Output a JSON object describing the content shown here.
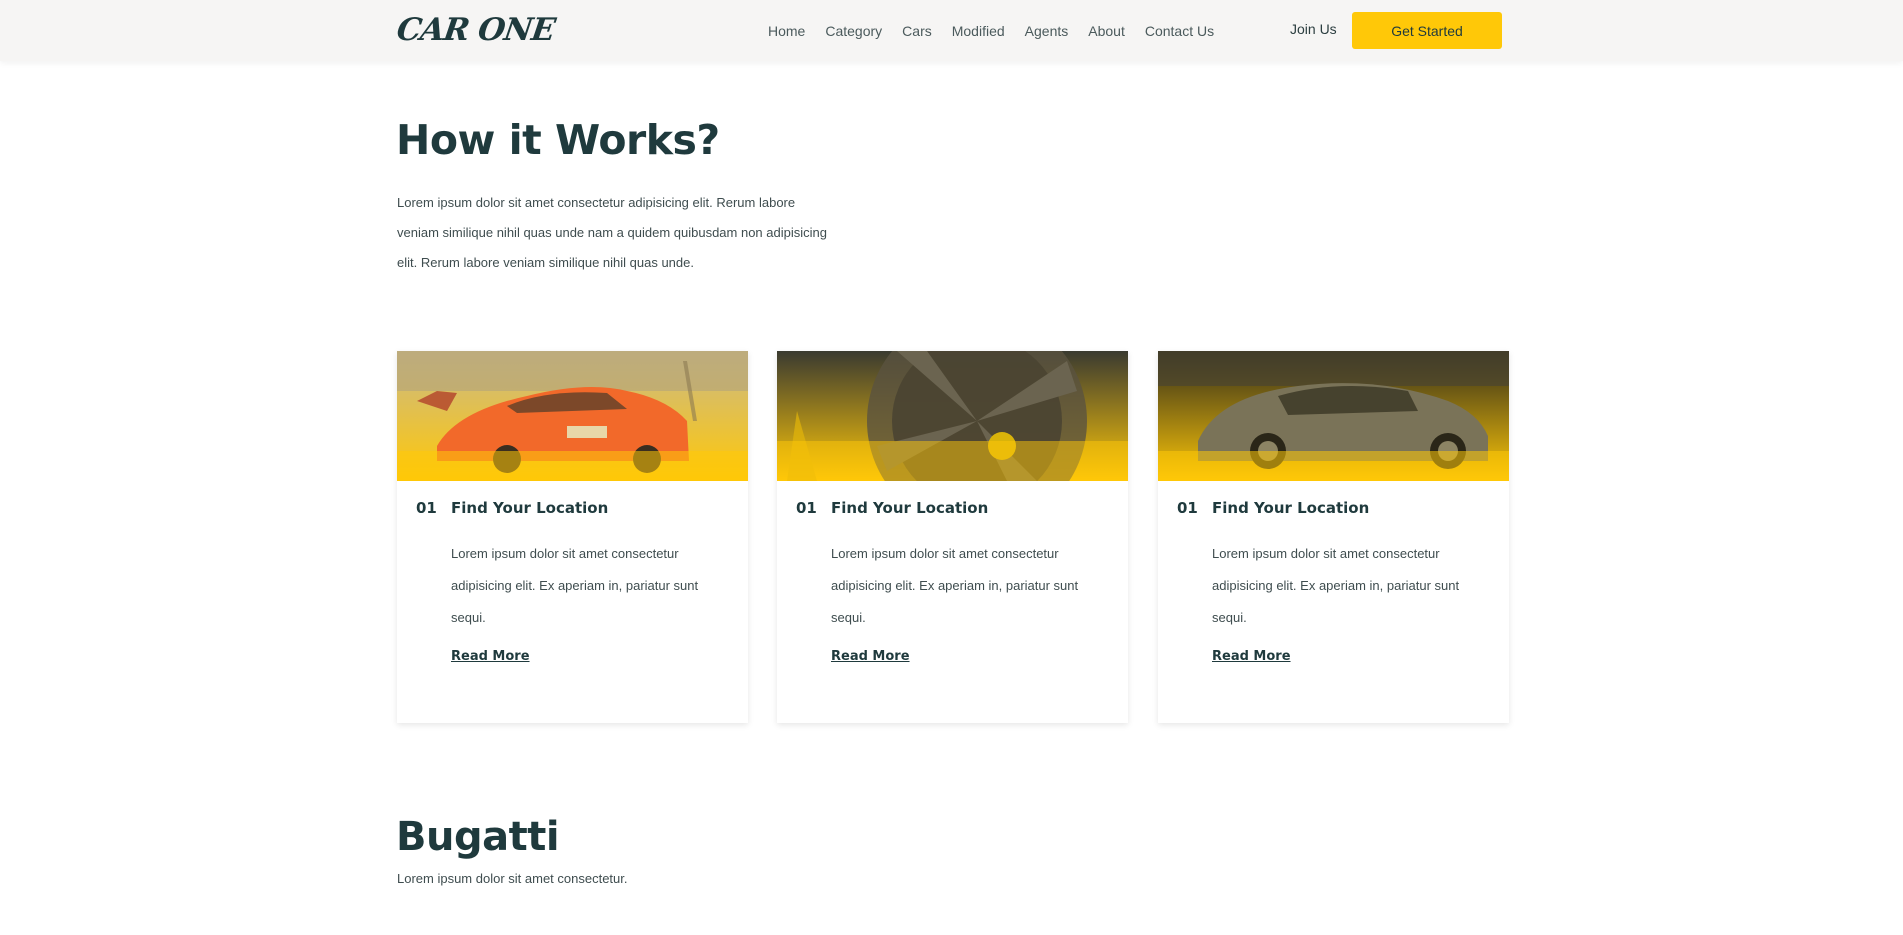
{
  "header": {
    "logo_text": "CAR ONE",
    "nav_items": [
      "Home",
      "Category",
      "Cars",
      "Modified",
      "Agents",
      "About",
      "Contact Us"
    ],
    "join_label": "Join Us",
    "cta_label": "Get Started",
    "cta_color": "#ffc808"
  },
  "how_it_works": {
    "title": "How it Works?",
    "description": "Lorem ipsum dolor sit amet consectetur adipisicing elit. Rerum labore veniam similique nihil quas unde nam a quidem quibusdam non adipisicing elit. Rerum labore veniam similique nihil quas unde.",
    "cards": [
      {
        "step": "01",
        "title": "Find Your Location",
        "text": "Lorem ipsum dolor sit amet consectetur adipisicing elit. Ex aperiam in, pariatur sunt sequi.",
        "link_label": "Read More",
        "image": "orange-sports-car"
      },
      {
        "step": "01",
        "title": "Find Your Location",
        "text": "Lorem ipsum dolor sit amet consectetur adipisicing elit. Ex aperiam in, pariatur sunt sequi.",
        "link_label": "Read More",
        "image": "car-wheel-closeup"
      },
      {
        "step": "01",
        "title": "Find Your Location",
        "text": "Lorem ipsum dolor sit amet consectetur adipisicing elit. Ex aperiam in, pariatur sunt sequi.",
        "link_label": "Read More",
        "image": "dark-grand-tourer"
      }
    ]
  },
  "bugatti": {
    "title": "Bugatti",
    "description": "Lorem ipsum dolor sit amet consectetur."
  }
}
